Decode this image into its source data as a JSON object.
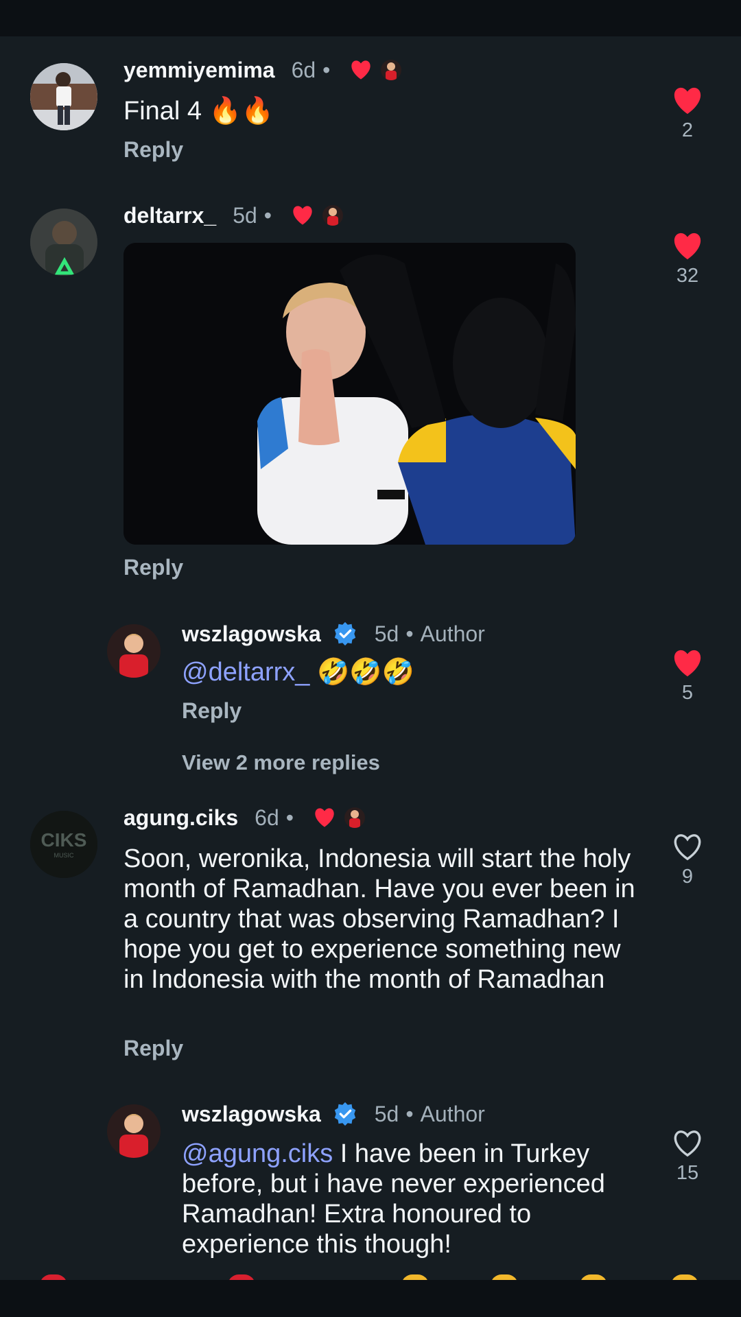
{
  "comments": [
    {
      "username": "yemmiyemima",
      "time": "6d",
      "text": "Final 4 🔥🔥",
      "reply_label": "Reply",
      "likes": "2",
      "liked": true,
      "creator_liked": true
    },
    {
      "username": "deltarrx_",
      "time": "5d",
      "has_gif": true,
      "reply_label": "Reply",
      "likes": "32",
      "liked": true,
      "creator_liked": true
    },
    {
      "username": "wszlagowska",
      "verified": true,
      "time": "5d",
      "author_label": "Author",
      "mention": "@deltarrx_",
      "text": " 🤣🤣🤣",
      "reply_label": "Reply",
      "likes": "5",
      "liked": true
    },
    {
      "username": "agung.ciks",
      "time": "6d",
      "text": "Soon, weronika, Indonesia will start the holy month of Ramadhan. Have you ever been in a country that was observing Ramadhan? I hope you get to experience something new in Indonesia with the month of Ramadhan",
      "reply_label": "Reply",
      "likes": "9",
      "liked": false,
      "creator_liked": true
    },
    {
      "username": "wszlagowska",
      "verified": true,
      "time": "5d",
      "author_label": "Author",
      "mention": "@agung.ciks",
      "text": " I have been in Turkey before, but i have never experienced Ramadhan! Extra honoured to experience this though!",
      "likes": "15",
      "liked": false
    }
  ],
  "view_more_replies": "View 2 more replies",
  "colors": {
    "background": "#161d22",
    "like_red": "#ff2a46",
    "mention_blue": "#8ea2ff",
    "verified_blue": "#3897f0",
    "muted_text": "#a3b0ba"
  },
  "icons": {
    "like": "heart-icon",
    "verified": "verified-badge-icon",
    "creator_liked": "creator-liked-heart-icon"
  }
}
